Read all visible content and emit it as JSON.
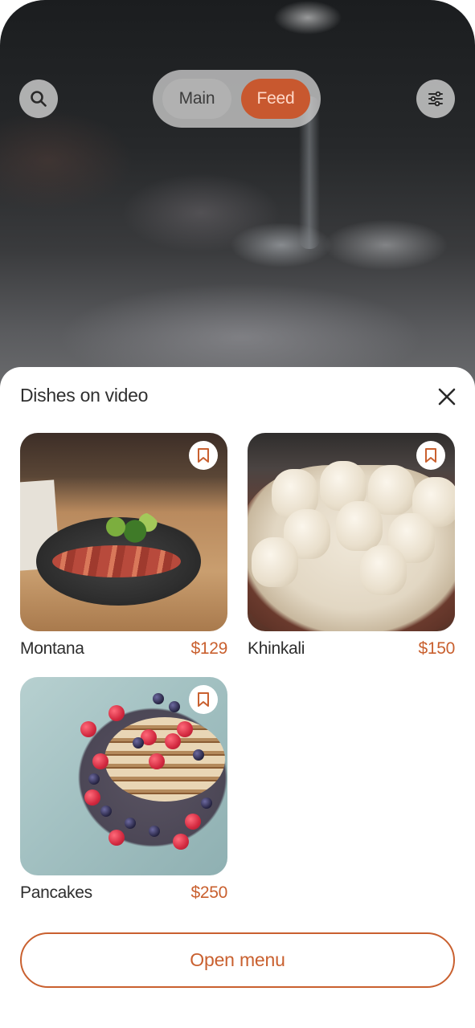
{
  "header": {
    "tabs": [
      {
        "label": "Main",
        "active": false
      },
      {
        "label": "Feed",
        "active": true
      }
    ]
  },
  "icons": {
    "search": "search-icon",
    "filter": "sliders-icon",
    "close": "close-icon",
    "bookmark": "bookmark-icon"
  },
  "sheet": {
    "title": "Dishes on video",
    "dishes": [
      {
        "name": "Montana",
        "price": "$129"
      },
      {
        "name": "Khinkali",
        "price": "$150"
      },
      {
        "name": "Pancakes",
        "price": "$250"
      }
    ],
    "open_menu_label": "Open menu"
  },
  "colors": {
    "accent": "#c9602f",
    "active_tab": "#c8582f"
  }
}
